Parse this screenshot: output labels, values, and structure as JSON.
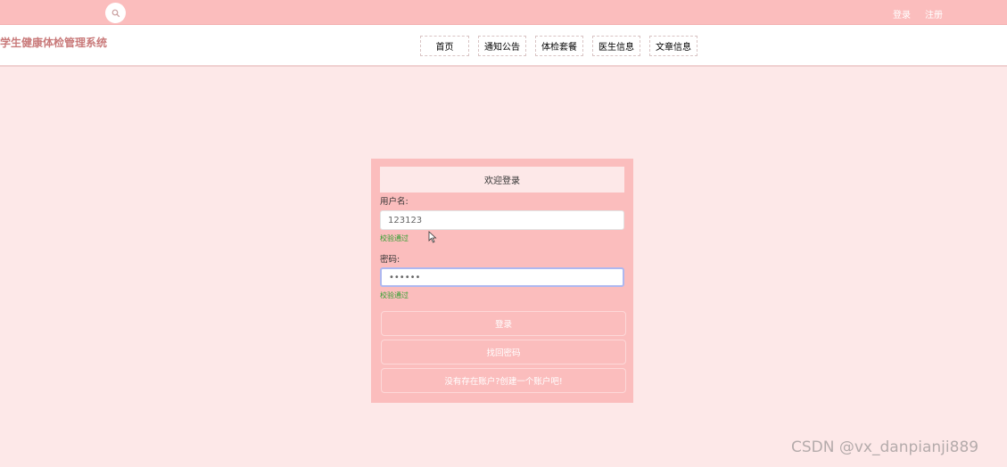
{
  "colors": {
    "primary": "#fbbdbd",
    "background": "#fde8e8",
    "title": "#c97a7a",
    "success": "#2ea02e"
  },
  "topbar": {
    "search_icon": "search-icon",
    "login_link": "登录",
    "register_link": "注册"
  },
  "header": {
    "site_title": "学生健康体检管理系统",
    "nav": [
      {
        "label": "首页"
      },
      {
        "label": "通知公告"
      },
      {
        "label": "体检套餐"
      },
      {
        "label": "医生信息"
      },
      {
        "label": "文章信息"
      }
    ]
  },
  "login": {
    "title": "欢迎登录",
    "username_label": "用户名:",
    "username_value": "123123",
    "username_status": "校验通过",
    "password_label": "密码:",
    "password_value": "••••••",
    "password_status": "校验通过",
    "login_button": "登录",
    "forgot_button": "找回密码",
    "register_button": "没有存在账户?创建一个账户吧!"
  },
  "watermark": "CSDN @vx_danpianji889"
}
